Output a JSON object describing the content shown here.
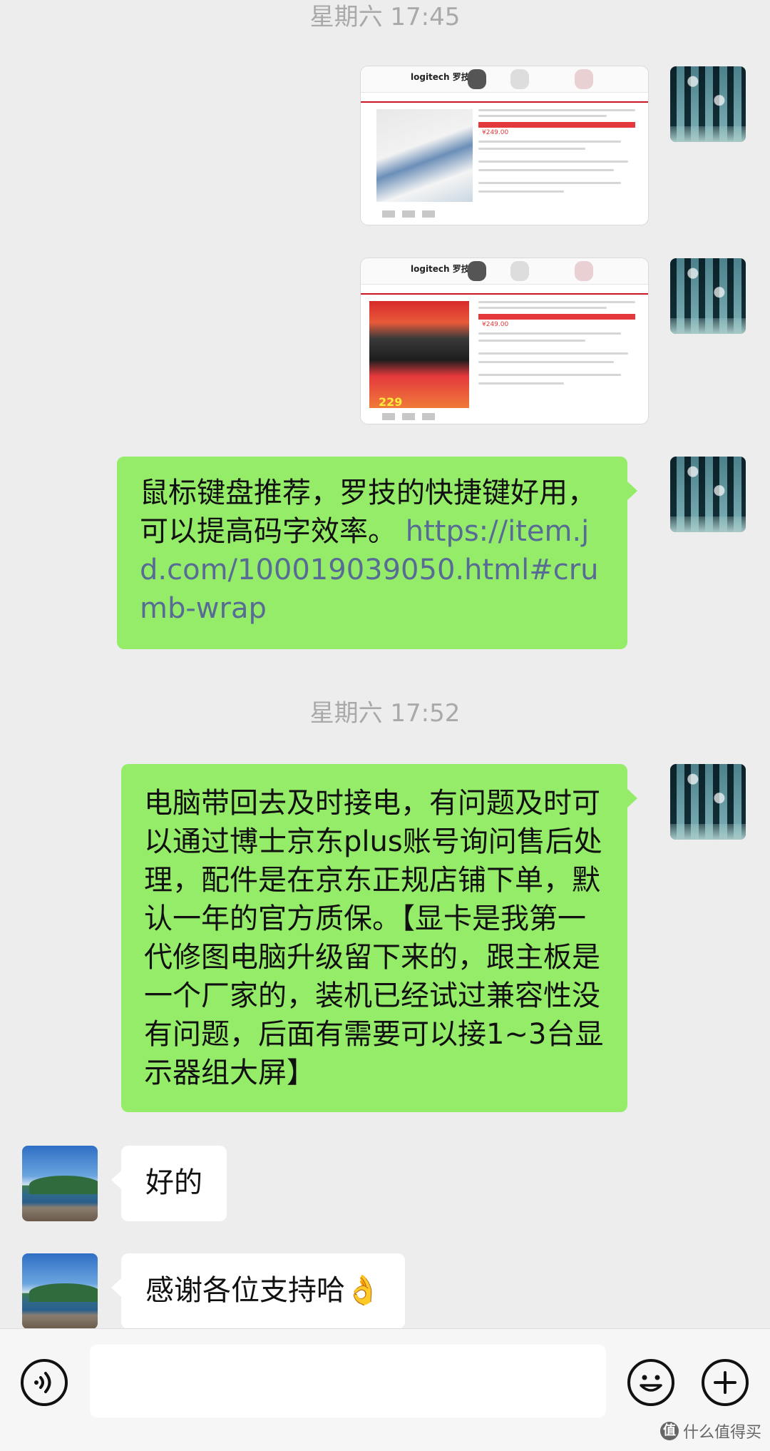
{
  "chat": {
    "timestamp_1": "星期六 17:45",
    "timestamp_2": "星期六 17:52",
    "messages": [
      {
        "text": "鼠标键盘推荐，罗技的快捷键好用，可以提高码字效率。",
        "link": "https://item.jd.com/100019039050.html#crumb-wrap"
      },
      {
        "text": "电脑带回去及时接电，有问题及时可以通过博士京东plus账号询问售后处理，配件是在京东正规店铺下单，默认一年的官方质保。【显卡是我第一代修图电脑升级留下来的，跟主板是一个厂家的，装机已经试过兼容性没有问题，后面有需要可以接1~3台显示器组大屏】"
      },
      {
        "text": "好的"
      },
      {
        "text": "感谢各位支持哈👌"
      }
    ],
    "screenshot_1": {
      "logo": "logitech 罗技",
      "price": "¥249.00"
    },
    "screenshot_2": {
      "logo": "logitech 罗技",
      "price": "¥249.00",
      "promo_price": "229"
    }
  },
  "input_bar": {
    "voice_icon": "voice-icon",
    "emoji_icon": "emoji-icon",
    "plus_icon": "plus-icon"
  },
  "watermark": {
    "text": "什么值得买",
    "badge": "值"
  },
  "colors": {
    "background": "#ededed",
    "bubble_self": "#95ec69",
    "bubble_other": "#ffffff",
    "link": "#576b95"
  }
}
